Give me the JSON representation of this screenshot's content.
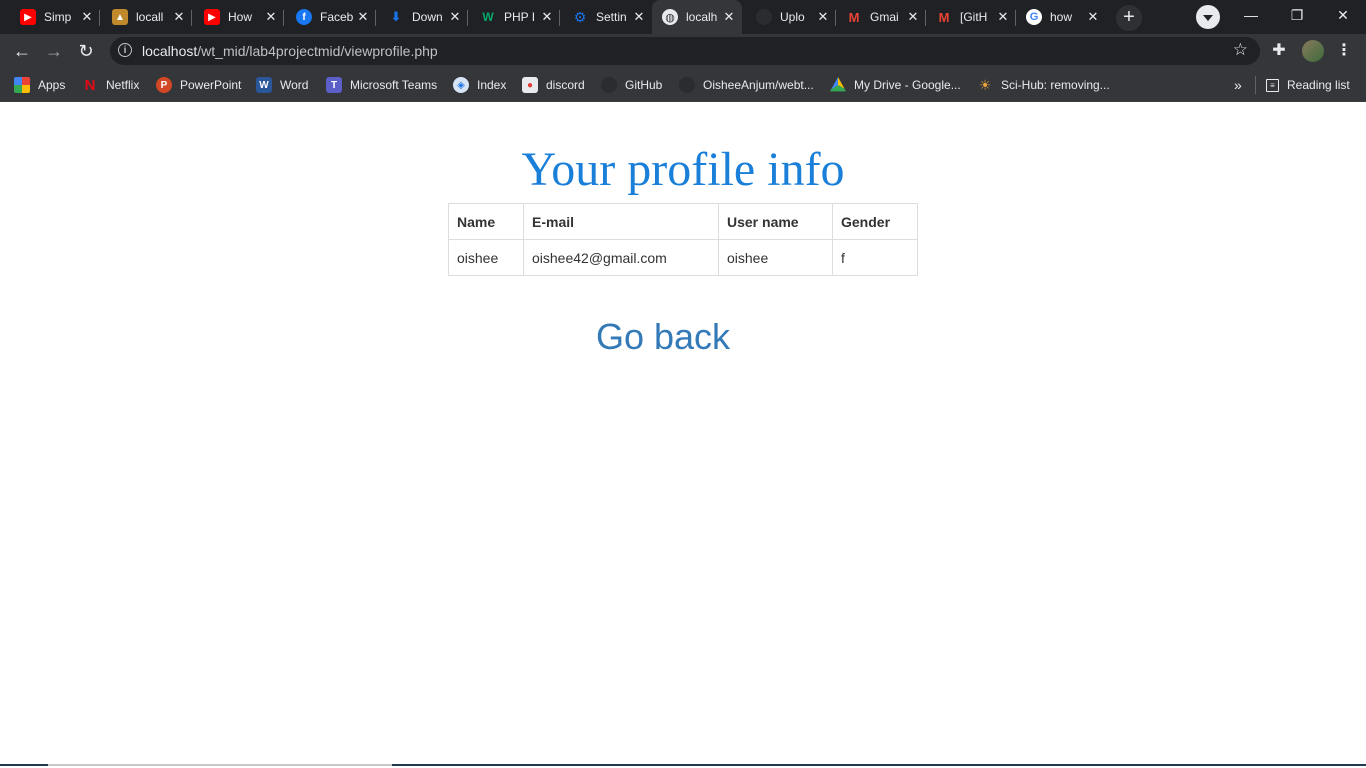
{
  "browser": {
    "tabs": [
      {
        "label": "Simp",
        "icon": "youtube-icon",
        "color": "#ff0000"
      },
      {
        "label": "locall",
        "icon": "localhost-logo-icon",
        "color": "#c08a2c"
      },
      {
        "label": "How",
        "icon": "youtube-icon",
        "color": "#ff0000"
      },
      {
        "label": "Faceb",
        "icon": "facebook-icon",
        "color": "#1877f2"
      },
      {
        "label": "Down",
        "icon": "download-icon",
        "color": "#1a73e8"
      },
      {
        "label": "PHP I",
        "icon": "w3-icon",
        "color": "#04aa6d"
      },
      {
        "label": "Settin",
        "icon": "gear-icon",
        "color": "#1a73e8"
      },
      {
        "label": "localh",
        "icon": "globe-icon",
        "color": "#e8eaed",
        "active": true
      },
      {
        "label": "Uplo",
        "icon": "github-icon",
        "color": "#202124"
      },
      {
        "label": "Gmai",
        "icon": "gmail-icon",
        "color": "#ea4335"
      },
      {
        "label": "[GitH",
        "icon": "gmail-icon",
        "color": "#ea4335"
      },
      {
        "label": "how",
        "icon": "google-icon",
        "color": "#4285f4"
      }
    ],
    "url_host": "localhost",
    "url_path": "/wt_mid/lab4projectmid/viewprofile.php",
    "bookmarks": [
      {
        "label": "Apps",
        "icon": "apps-grid-icon"
      },
      {
        "label": "Netflix",
        "icon": "netflix-icon"
      },
      {
        "label": "PowerPoint",
        "icon": "powerpoint-icon"
      },
      {
        "label": "Word",
        "icon": "word-icon"
      },
      {
        "label": "Microsoft Teams",
        "icon": "teams-icon"
      },
      {
        "label": "Index",
        "icon": "shield-icon"
      },
      {
        "label": "discord",
        "icon": "discord-icon"
      },
      {
        "label": "GitHub",
        "icon": "github-icon"
      },
      {
        "label": "OisheeAnjum/webt...",
        "icon": "github-icon"
      },
      {
        "label": "My Drive - Google...",
        "icon": "drive-icon"
      },
      {
        "label": "Sci-Hub: removing...",
        "icon": "scihub-icon"
      }
    ],
    "bookmarks_more": "»",
    "reading_list": "Reading list"
  },
  "page": {
    "title": "Your profile info",
    "table": {
      "headers": [
        "Name",
        "E-mail",
        "User name",
        "Gender"
      ],
      "rows": [
        [
          "oishee",
          "oishee42@gmail.com",
          "oishee",
          "f"
        ]
      ]
    },
    "go_back": "Go back"
  },
  "colors": {
    "title": "#1a7fd8",
    "link": "#337ab7",
    "chrome_dark": "#202124",
    "chrome_toolbar": "#35363a"
  }
}
